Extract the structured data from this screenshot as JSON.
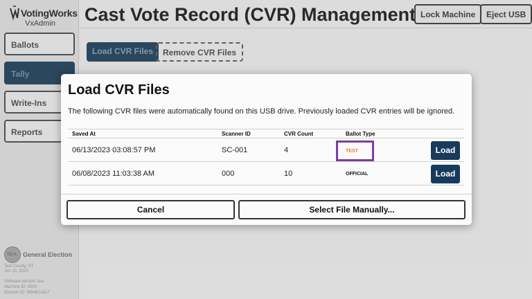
{
  "brand": {
    "name": "VotingWorks",
    "product": "VxAdmin"
  },
  "sidebar": {
    "items": [
      {
        "label": "Ballots",
        "active": false
      },
      {
        "label": "Tally",
        "active": true
      },
      {
        "label": "Write-Ins",
        "active": false
      },
      {
        "label": "Reports",
        "active": false
      }
    ]
  },
  "election": {
    "seal_text": "SEAL",
    "title": "General Election",
    "lines": [
      "Test County, ST",
      "Jun 13, 2023",
      "Software version: dev",
      "Machine ID: 0000",
      "Election ID: 5654b7a317"
    ]
  },
  "header": {
    "title": "Cast Vote Record (CVR) Management",
    "lock_label": "Lock Machine",
    "eject_label": "Eject USB"
  },
  "tabs": {
    "load_label": "Load CVR Files",
    "remove_label": "Remove CVR Files"
  },
  "modal": {
    "title": "Load CVR Files",
    "description": "The following CVR files were automatically found on this USB drive. Previously loaded CVR entries will be ignored.",
    "columns": [
      "Saved At",
      "Scanner ID",
      "CVR Count",
      "Ballot Type"
    ],
    "rows": [
      {
        "saved_at": "06/13/2023 03:08:57 PM",
        "scanner_id": "SC-001",
        "cvr_count": "4",
        "ballot_type": "TEST",
        "action": "Load"
      },
      {
        "saved_at": "06/08/2023 11:03:38 AM",
        "scanner_id": "000",
        "cvr_count": "10",
        "ballot_type": "OFFICIAL",
        "action": "Load"
      }
    ],
    "cancel_label": "Cancel",
    "select_label": "Select File Manually..."
  },
  "colors": {
    "primary": "#173b5c",
    "highlight": "#7b3fa0",
    "test_badge": "#e07a2a"
  }
}
